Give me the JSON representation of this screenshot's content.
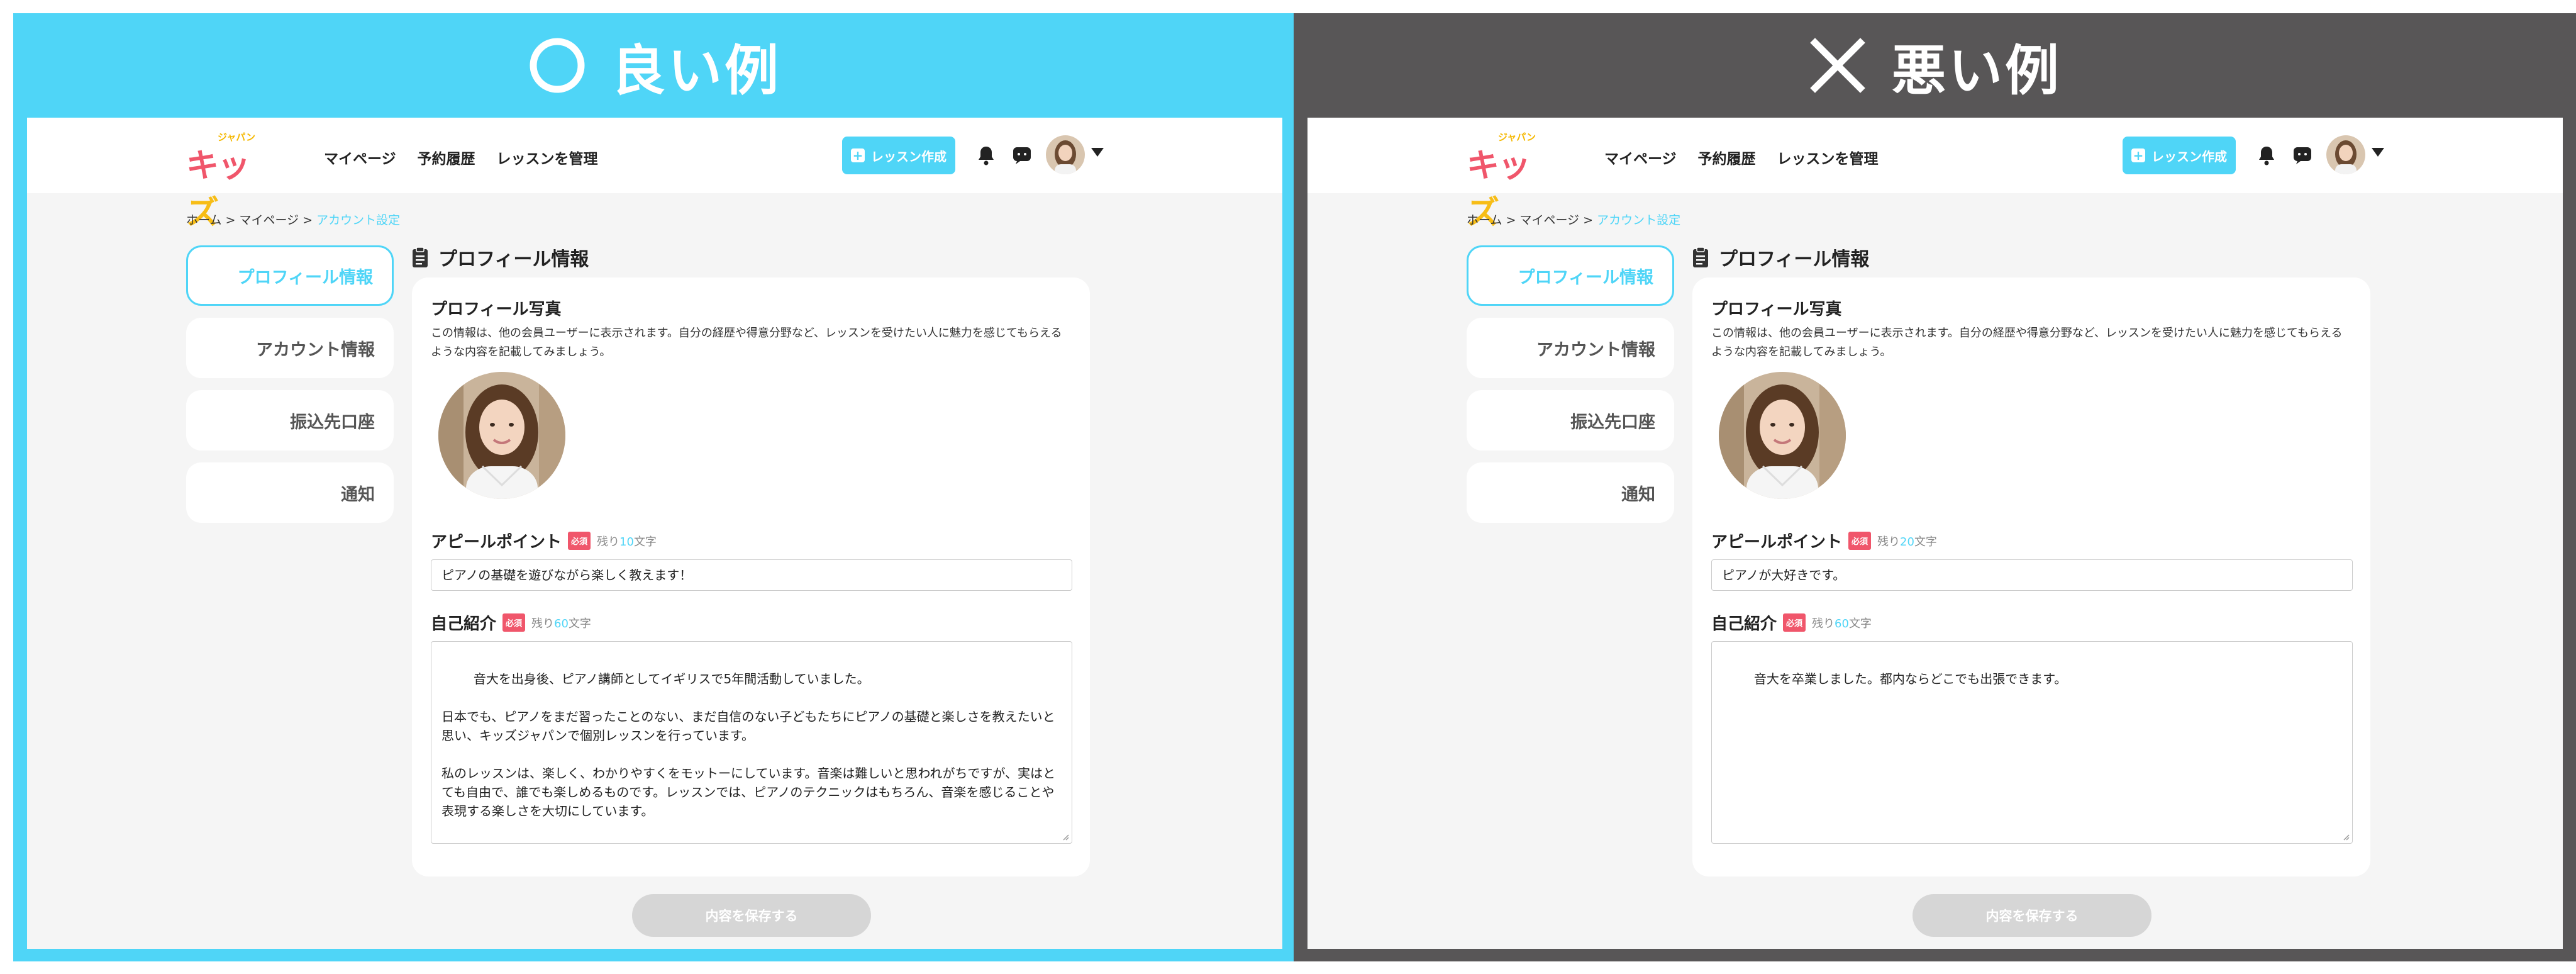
{
  "panels": [
    {
      "banner": {
        "symbol": "○",
        "title": "良い例"
      },
      "header": {
        "logo": {
          "small": "ジャパン",
          "main_a": "キッ",
          "main_b": "ズ"
        },
        "nav": [
          "マイページ",
          "予約履歴",
          "レッスンを管理"
        ],
        "create_button": "レッスン作成"
      },
      "breadcrumb": {
        "home": "ホーム",
        "mypage": "マイページ",
        "current": "アカウント設定",
        "sep": ">"
      },
      "sidebar": [
        "プロフィール情報",
        "アカウント情報",
        "振込先口座",
        "通知"
      ],
      "section_title": "プロフィール情報",
      "photo_label": "プロフィール写真",
      "photo_desc": "この情報は、他の会員ユーザーに表示されます。自分の経歴や得意分野など、レッスンを受けたい人に魅力を感じてもらえるような内容を記載してみましょう。",
      "appeal": {
        "label": "アピールポイント",
        "required": "必須",
        "remain_prefix": "残り",
        "remain_count": "10",
        "remain_suffix": "文字",
        "value": "ピアノの基礎を遊びながら楽しく教えます！"
      },
      "intro": {
        "label": "自己紹介",
        "required": "必須",
        "remain_prefix": "残り",
        "remain_count": "60",
        "remain_suffix": "文字",
        "value": "音大を出身後、ピアノ講師としてイギリスで5年間活動していました。\n\n日本でも、ピアノをまだ習ったことのない、まだ自信のない子どもたちにピアノの基礎と楽しさを教えたいと思い、キッズジャパンで個別レッスンを行っています。\n\n私のレッスンは、楽しく、わかりやすくをモットーにしています。音楽は難しいと思われがちですが、実はとても自由で、誰でも楽しめるものです。レッスンでは、ピアノのテクニックはもちろん、音楽を感じることや表現する楽しさを大切にしています。\n\nよろしくお願いいたします！"
      },
      "save_button": "内容を保存する"
    },
    {
      "banner": {
        "symbol": "✕",
        "title": "悪い例"
      },
      "header": {
        "logo": {
          "small": "ジャパン",
          "main_a": "キッ",
          "main_b": "ズ"
        },
        "nav": [
          "マイページ",
          "予約履歴",
          "レッスンを管理"
        ],
        "create_button": "レッスン作成"
      },
      "breadcrumb": {
        "home": "ホーム",
        "mypage": "マイページ",
        "current": "アカウント設定",
        "sep": ">"
      },
      "sidebar": [
        "プロフィール情報",
        "アカウント情報",
        "振込先口座",
        "通知"
      ],
      "section_title": "プロフィール情報",
      "photo_label": "プロフィール写真",
      "photo_desc": "この情報は、他の会員ユーザーに表示されます。自分の経歴や得意分野など、レッスンを受けたい人に魅力を感じてもらえるような内容を記載してみましょう。",
      "appeal": {
        "label": "アピールポイント",
        "required": "必須",
        "remain_prefix": "残り",
        "remain_count": "20",
        "remain_suffix": "文字",
        "value": "ピアノが大好きです。"
      },
      "intro": {
        "label": "自己紹介",
        "required": "必須",
        "remain_prefix": "残り",
        "remain_count": "60",
        "remain_suffix": "文字",
        "value": "音大を卒業しました。都内ならどこでも出張できます。"
      },
      "save_button": "内容を保存する"
    }
  ],
  "colors": {
    "good": "#4fd5f7",
    "bad": "#585657",
    "accent": "#4fd5f7",
    "required": "#f0566b",
    "logo_red": "#f0566b",
    "logo_yellow": "#f7bd16"
  },
  "icons": [
    "circle-icon",
    "cross-icon",
    "plus-icon",
    "bell-icon",
    "chat-icon",
    "caret-down-icon",
    "clipboard-icon",
    "resize-grip-icon"
  ]
}
